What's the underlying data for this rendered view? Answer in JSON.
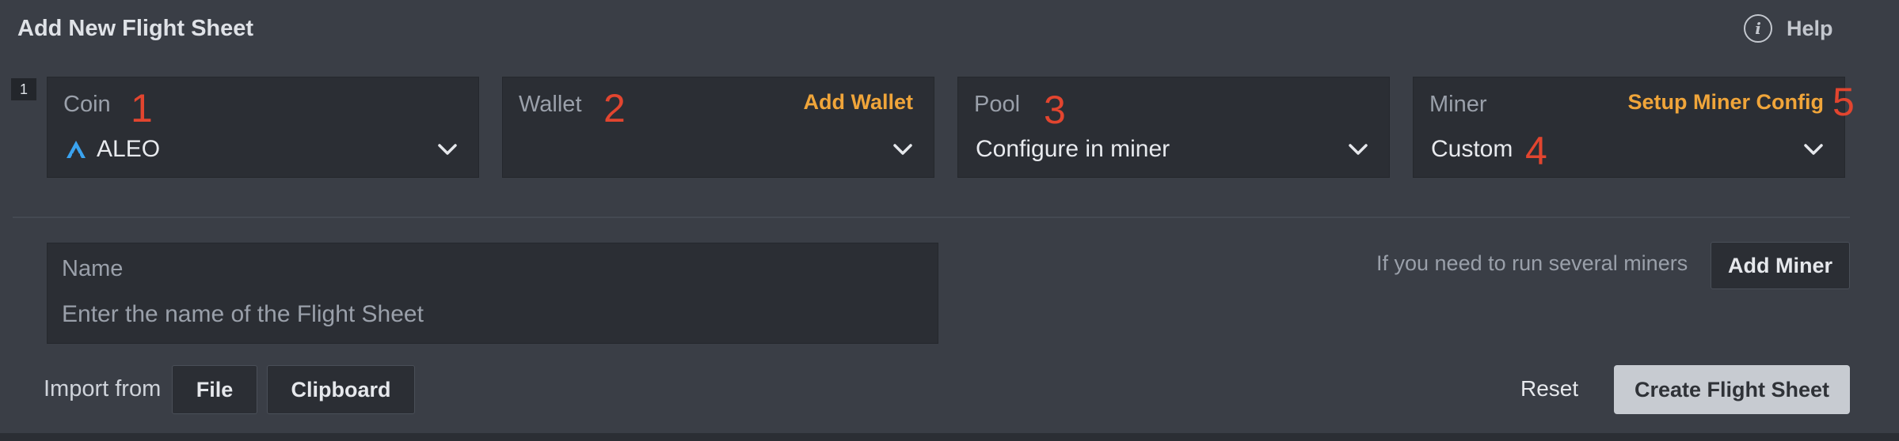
{
  "header": {
    "title": "Add New Flight Sheet",
    "help_label": "Help",
    "help_icon": "info-icon"
  },
  "row_index": "1",
  "coin": {
    "label": "Coin",
    "value": "ALEO",
    "icon": "aleo-logo-icon"
  },
  "wallet": {
    "label": "Wallet",
    "value": "",
    "link": "Add Wallet"
  },
  "pool": {
    "label": "Pool",
    "value": "Configure in miner"
  },
  "miner": {
    "label": "Miner",
    "value": "Custom",
    "link": "Setup Miner Config"
  },
  "annotations": [
    "1",
    "2",
    "3",
    "4",
    "5"
  ],
  "name": {
    "label": "Name",
    "placeholder": "Enter the name of the Flight Sheet"
  },
  "add_miner": {
    "hint": "If you need to run several miners",
    "button": "Add Miner"
  },
  "import": {
    "label": "Import from",
    "file_button": "File",
    "clipboard_button": "Clipboard"
  },
  "actions": {
    "reset": "Reset",
    "create": "Create Flight Sheet"
  },
  "colors": {
    "accent_link": "#f0a53a",
    "annotation_red": "#e2452f",
    "background": "#3a3e46",
    "field_bg": "#2b2e34"
  }
}
